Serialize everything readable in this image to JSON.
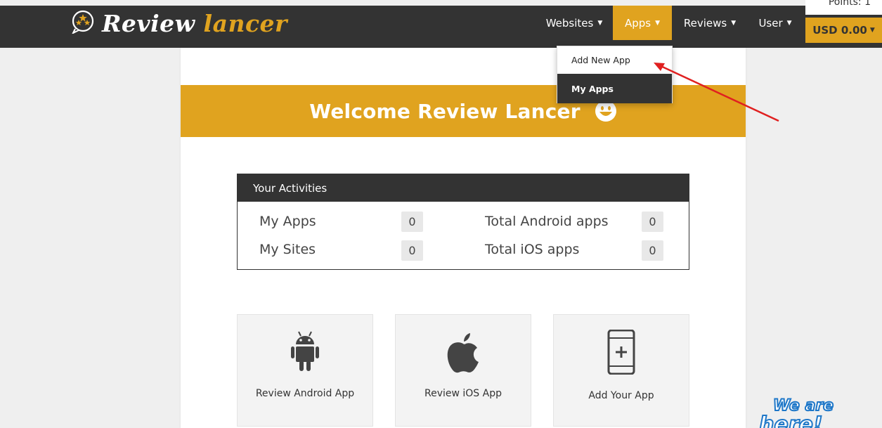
{
  "brand": {
    "word1": "Review",
    "word2": "lancer"
  },
  "nav": {
    "websites": "Websites",
    "apps": "Apps",
    "reviews": "Reviews",
    "user": "User",
    "points": "Points: 1",
    "currency": "USD 0.00"
  },
  "apps_menu": {
    "add_new": "Add New App",
    "my_apps": "My Apps"
  },
  "welcome": "Welcome Review Lancer",
  "activities": {
    "title": "Your Activities",
    "rows": [
      {
        "label": "My Apps",
        "value": "0"
      },
      {
        "label": "My Sites",
        "value": "0"
      },
      {
        "label": "Total Android apps",
        "value": "0"
      },
      {
        "label": "Total iOS apps",
        "value": "0"
      }
    ]
  },
  "cards": [
    {
      "label": "Review Android App",
      "icon": "android-icon"
    },
    {
      "label": "Review iOS App",
      "icon": "apple-icon"
    },
    {
      "label": "Add Your App",
      "icon": "add-mobile-icon"
    }
  ],
  "watermark": {
    "line1": "We are",
    "line2": "here!"
  },
  "colors": {
    "accent": "#e0a31f",
    "dark": "#333333",
    "annotation": "#e02020"
  }
}
